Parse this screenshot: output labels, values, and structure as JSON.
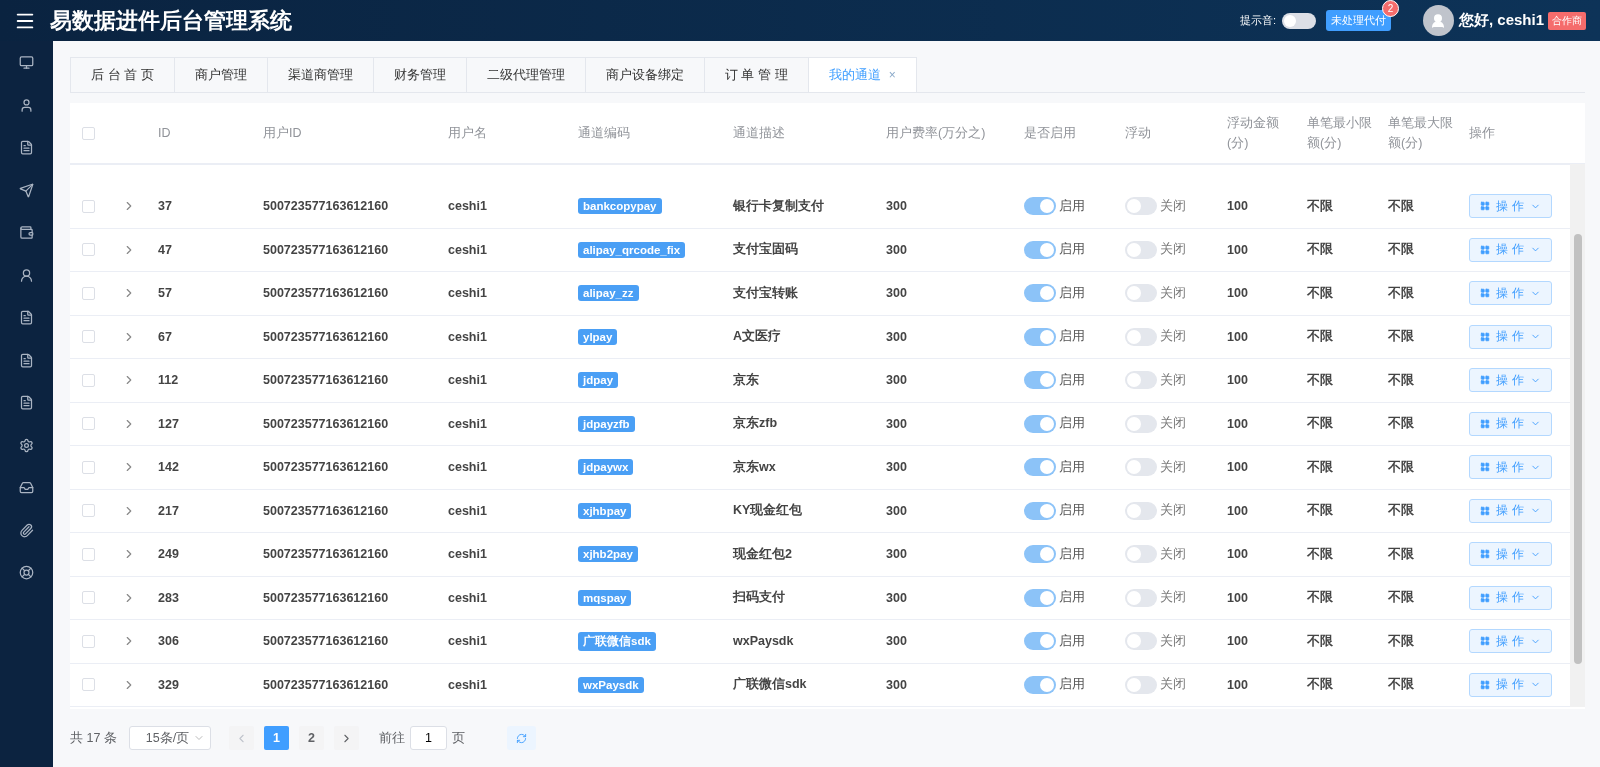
{
  "header": {
    "title": "易数据进件后台管理系统",
    "sound_label": "提示音:",
    "sound_on": false,
    "pending_button": "未处理代付",
    "pending_count": "2",
    "greeting": "您好, ceshi1",
    "role_tag": "合作商"
  },
  "tabs": [
    {
      "label": "后 台 首 页",
      "selected": false,
      "closable": false
    },
    {
      "label": "商户管理",
      "selected": false,
      "closable": false
    },
    {
      "label": "渠道商管理",
      "selected": false,
      "closable": false
    },
    {
      "label": "财务管理",
      "selected": false,
      "closable": false
    },
    {
      "label": "二级代理管理",
      "selected": false,
      "closable": false
    },
    {
      "label": "商户设备绑定",
      "selected": false,
      "closable": false
    },
    {
      "label": "订 单 管 理",
      "selected": false,
      "closable": false
    },
    {
      "label": "我的通道",
      "selected": true,
      "closable": true,
      "close": "×"
    }
  ],
  "table": {
    "select_all_checked": false,
    "columns": [
      "ID",
      "用户ID",
      "用户名",
      "通道编码",
      "通道描述",
      "用户费率(万分之)",
      "是否启用",
      "浮动",
      "浮动金额(分)",
      "单笔最小限额(分)",
      "单笔最大限额(分)",
      "操作"
    ],
    "rows": [
      {
        "checked": false,
        "id": "37",
        "user_id": "500723577163612160",
        "username": "ceshi1",
        "code": "bankcopypay",
        "description": "银行卡复制支付",
        "rate": "300",
        "enabled": {
          "on": true,
          "label": "启用"
        },
        "floating": {
          "on": false,
          "label": "关闭"
        },
        "amount": "100",
        "min": "不限",
        "max": "不限",
        "action": "操 作"
      },
      {
        "checked": false,
        "id": "47",
        "user_id": "500723577163612160",
        "username": "ceshi1",
        "code": "alipay_qrcode_fix",
        "description": "支付宝固码",
        "rate": "300",
        "enabled": {
          "on": true,
          "label": "启用"
        },
        "floating": {
          "on": false,
          "label": "关闭"
        },
        "amount": "100",
        "min": "不限",
        "max": "不限",
        "action": "操 作"
      },
      {
        "checked": false,
        "id": "57",
        "user_id": "500723577163612160",
        "username": "ceshi1",
        "code": "alipay_zz",
        "description": "支付宝转账",
        "rate": "300",
        "enabled": {
          "on": true,
          "label": "启用"
        },
        "floating": {
          "on": false,
          "label": "关闭"
        },
        "amount": "100",
        "min": "不限",
        "max": "不限",
        "action": "操 作"
      },
      {
        "checked": false,
        "id": "67",
        "user_id": "500723577163612160",
        "username": "ceshi1",
        "code": "ylpay",
        "description": "A文医疗",
        "rate": "300",
        "enabled": {
          "on": true,
          "label": "启用"
        },
        "floating": {
          "on": false,
          "label": "关闭"
        },
        "amount": "100",
        "min": "不限",
        "max": "不限",
        "action": "操 作"
      },
      {
        "checked": false,
        "id": "112",
        "user_id": "500723577163612160",
        "username": "ceshi1",
        "code": "jdpay",
        "description": "京东",
        "rate": "300",
        "enabled": {
          "on": true,
          "label": "启用"
        },
        "floating": {
          "on": false,
          "label": "关闭"
        },
        "amount": "100",
        "min": "不限",
        "max": "不限",
        "action": "操 作"
      },
      {
        "checked": false,
        "id": "127",
        "user_id": "500723577163612160",
        "username": "ceshi1",
        "code": "jdpayzfb",
        "description": "京东zfb",
        "rate": "300",
        "enabled": {
          "on": true,
          "label": "启用"
        },
        "floating": {
          "on": false,
          "label": "关闭"
        },
        "amount": "100",
        "min": "不限",
        "max": "不限",
        "action": "操 作"
      },
      {
        "checked": false,
        "id": "142",
        "user_id": "500723577163612160",
        "username": "ceshi1",
        "code": "jdpaywx",
        "description": "京东wx",
        "rate": "300",
        "enabled": {
          "on": true,
          "label": "启用"
        },
        "floating": {
          "on": false,
          "label": "关闭"
        },
        "amount": "100",
        "min": "不限",
        "max": "不限",
        "action": "操 作"
      },
      {
        "checked": false,
        "id": "217",
        "user_id": "500723577163612160",
        "username": "ceshi1",
        "code": "xjhbpay",
        "description": "KY现金红包",
        "rate": "300",
        "enabled": {
          "on": true,
          "label": "启用"
        },
        "floating": {
          "on": false,
          "label": "关闭"
        },
        "amount": "100",
        "min": "不限",
        "max": "不限",
        "action": "操 作"
      },
      {
        "checked": false,
        "id": "249",
        "user_id": "500723577163612160",
        "username": "ceshi1",
        "code": "xjhb2pay",
        "description": "现金红包2",
        "rate": "300",
        "enabled": {
          "on": true,
          "label": "启用"
        },
        "floating": {
          "on": false,
          "label": "关闭"
        },
        "amount": "100",
        "min": "不限",
        "max": "不限",
        "action": "操 作"
      },
      {
        "checked": false,
        "id": "283",
        "user_id": "500723577163612160",
        "username": "ceshi1",
        "code": "mqspay",
        "description": "扫码支付",
        "rate": "300",
        "enabled": {
          "on": true,
          "label": "启用"
        },
        "floating": {
          "on": false,
          "label": "关闭"
        },
        "amount": "100",
        "min": "不限",
        "max": "不限",
        "action": "操 作"
      },
      {
        "checked": false,
        "id": "306",
        "user_id": "500723577163612160",
        "username": "ceshi1",
        "code": "广联微信sdk",
        "description": "wxPaysdk",
        "rate": "300",
        "enabled": {
          "on": true,
          "label": "启用"
        },
        "floating": {
          "on": false,
          "label": "关闭"
        },
        "amount": "100",
        "min": "不限",
        "max": "不限",
        "action": "操 作"
      },
      {
        "checked": false,
        "id": "329",
        "user_id": "500723577163612160",
        "username": "ceshi1",
        "code": "wxPaysdk",
        "description": "广联微信sdk",
        "rate": "300",
        "enabled": {
          "on": true,
          "label": "启用"
        },
        "floating": {
          "on": false,
          "label": "关闭"
        },
        "amount": "100",
        "min": "不限",
        "max": "不限",
        "action": "操 作"
      }
    ]
  },
  "pagination": {
    "total": "共 17 条",
    "page_size": "15条/页",
    "pages": [
      {
        "label": "1",
        "selected": true
      },
      {
        "label": "2",
        "selected": false
      }
    ],
    "goto_label": "前往",
    "goto_value": "1",
    "goto_suffix": "页"
  }
}
